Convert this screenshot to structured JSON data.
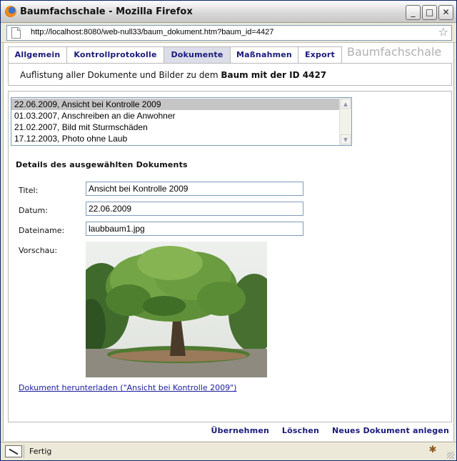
{
  "window": {
    "title": "Baumfachschale - Mozilla Firefox"
  },
  "urlbar": {
    "url": "http://localhost:8080/web-null33/baum_dokument.htm?baum_id=4427"
  },
  "tabs": [
    {
      "label": "Allgemein",
      "active": false
    },
    {
      "label": "Kontrollprotokolle",
      "active": false
    },
    {
      "label": "Dokumente",
      "active": true
    },
    {
      "label": "Maßnahmen",
      "active": false
    },
    {
      "label": "Export",
      "active": false
    }
  ],
  "brand": "Baumfachschale",
  "info": {
    "prefix": "Auflistung aller Dokumente und Bilder zu dem ",
    "bold": "Baum mit der ID 4427"
  },
  "documents": [
    {
      "label": "22.06.2009, Ansicht bei Kontrolle 2009",
      "selected": true
    },
    {
      "label": "01.03.2007, Anschreiben an die Anwohner",
      "selected": false
    },
    {
      "label": "21.02.2007, Bild mit Sturmschäden",
      "selected": false
    },
    {
      "label": "17.12.2003, Photo ohne Laub",
      "selected": false
    }
  ],
  "details": {
    "heading": "Details des ausgewählten Dokuments",
    "title_label": "Titel:",
    "title_value": "Ansicht bei Kontrolle 2009",
    "date_label": "Datum:",
    "date_value": "22.06.2009",
    "filename_label": "Dateiname:",
    "filename_value": "laubbaum1.jpg",
    "preview_label": "Vorschau:",
    "download_link": "Dokument herunterladen (\"Ansicht bei Kontrolle 2009\")"
  },
  "actions": {
    "apply": "Übernehmen",
    "delete": "Löschen",
    "new_document": "Neues Dokument anlegen"
  },
  "status": {
    "text": "Fertig"
  },
  "colors": {
    "link": "#1a1a7a",
    "active_tab": "#dbdee8",
    "selected_row": "#c5c5c5"
  }
}
